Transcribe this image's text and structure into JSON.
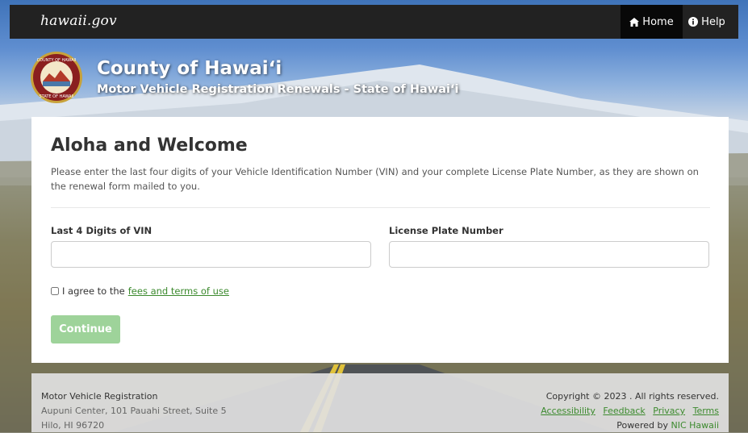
{
  "topnav": {
    "brand": "hawaii.gov",
    "home_label": "Home",
    "help_label": "Help"
  },
  "header": {
    "title": "County of Hawaiʻi",
    "subtitle": "Motor Vehicle Registration Renewals - State of Hawaiʻi",
    "seal_top_text": "COUNTY OF HAWAII",
    "seal_bottom_text": "STATE OF HAWAII"
  },
  "main": {
    "heading": "Aloha and Welcome",
    "intro": "Please enter the last four digits of your Vehicle Identification Number (VIN) and your complete License Plate Number, as they are shown on the renewal form mailed to you.",
    "vin_label": "Last 4 Digits of VIN",
    "vin_value": "",
    "plate_label": "License Plate Number",
    "plate_value": "",
    "agree_prefix": "I agree to the",
    "agree_link": "fees and terms of use",
    "continue_label": "Continue"
  },
  "footer": {
    "org": "Motor Vehicle Registration",
    "address_line1": "Aupuni Center, 101 Pauahi Street, Suite 5",
    "address_line2": "Hilo, HI 96720",
    "copyright": "Copyright © 2023 . All rights reserved.",
    "links": [
      "Accessibility",
      "Feedback",
      "Privacy",
      "Terms"
    ],
    "powered_prefix": "Powered by",
    "powered_link": "NIC Hawaii"
  },
  "colors": {
    "nav_bg": "#222222",
    "link_green": "#3c8a2e",
    "button_disabled": "#9ed39a"
  }
}
